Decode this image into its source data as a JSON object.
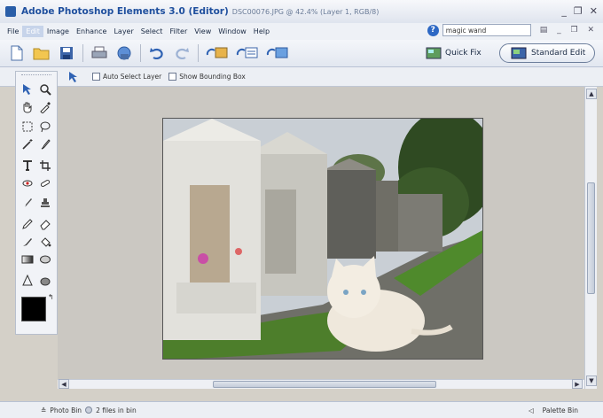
{
  "window": {
    "title": "Adobe Photoshop Elements 3.0 (Editor)",
    "subtitle": "DSC00076.JPG @ 42.4% (Layer 1, RGB/8)",
    "minimize": "_",
    "restore": "❐",
    "close": "✕"
  },
  "menu": {
    "items": [
      "File",
      "Edit",
      "Image",
      "Enhance",
      "Layer",
      "Select",
      "Filter",
      "View",
      "Window",
      "Help"
    ],
    "active_index": 1,
    "help_search": {
      "value": "magic wand"
    },
    "inner_window_controls": "▤ _ ❐ ✕"
  },
  "shortcuts": {
    "quick_fix": "Quick Fix",
    "standard_edit": "Standard Edit"
  },
  "options": {
    "auto_select_layer": "Auto Select Layer",
    "show_bounding_box": "Show Bounding Box"
  },
  "status": {
    "photo_bin": "Photo Bin",
    "files_in_bin": "2 files in bin",
    "palette_bin": "Palette Bin"
  },
  "colors": {
    "title_text": "#1f4f9e",
    "menu_bg": "#eef1f6",
    "canvas_bg": "#cbc8c2",
    "foreground_color": "#000000"
  }
}
